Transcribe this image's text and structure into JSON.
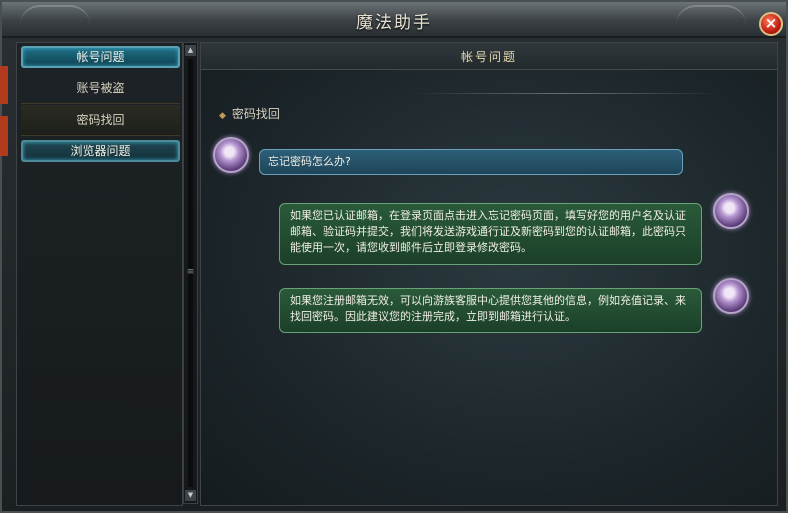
{
  "window": {
    "title": "魔法助手",
    "close_label": "×"
  },
  "sidebar": {
    "categories": [
      {
        "label": "帐号问题",
        "expanded": true,
        "items": [
          {
            "label": "账号被盗"
          },
          {
            "label": "密码找回",
            "selected": true
          }
        ]
      },
      {
        "label": "浏览器问题",
        "expanded": false
      }
    ]
  },
  "main": {
    "header_title": "帐号问题",
    "section_title": "密码找回",
    "question": "忘记密码怎么办?",
    "answers": [
      "如果您已认证邮箱，在登录页面点击进入忘记密码页面，填写好您的用户名及认证邮箱、验证码并提交，我们将发送游戏通行证及新密码到您的认证邮箱，此密码只能使用一次，请您收到邮件后立即登录修改密码。",
      "如果您注册邮箱无效，可以向游族客服中心提供您其他的信息，例如充值记录、来找回密码。因此建议您的注册完成，立即到邮箱进行认证。"
    ]
  },
  "scrollbar": {
    "up_arrow": "▲",
    "down_arrow": "▼",
    "grip": "≡"
  },
  "colors": {
    "accent": "#1f6f86",
    "question_bubble": "#2d5f78",
    "answer_bubble": "#2a5a3a",
    "close": "#c21d10"
  }
}
